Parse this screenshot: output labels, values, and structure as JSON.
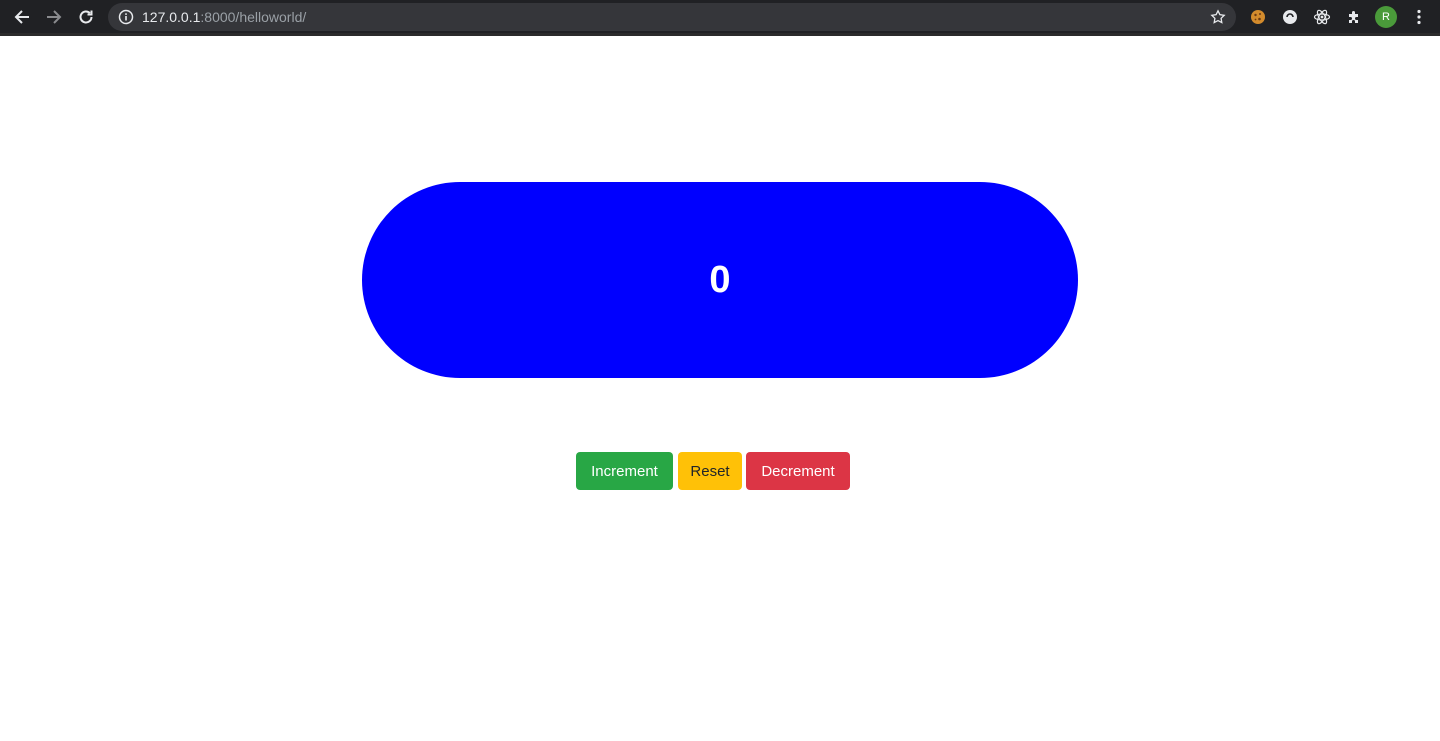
{
  "browser": {
    "url_host": "127.0.0.1",
    "url_path": ":8000/helloworld/",
    "profile_initial": "R"
  },
  "icons": {
    "back": "arrow-left-icon",
    "forward": "arrow-right-icon",
    "reload": "reload-icon",
    "site_info": "info-icon",
    "bookmark": "star-icon",
    "ext1": "cookie-icon",
    "ext2": "circle-extension-icon",
    "ext3": "react-atom-icon",
    "ext4": "puzzle-icon",
    "menu": "kebab-menu-icon"
  },
  "counter": {
    "value": "0",
    "color": "#0000ff"
  },
  "controls": {
    "increment_label": "Increment",
    "reset_label": "Reset",
    "decrement_label": "Decrement",
    "increment_color": "#28a745",
    "reset_color": "#ffc107",
    "decrement_color": "#dc3545"
  }
}
